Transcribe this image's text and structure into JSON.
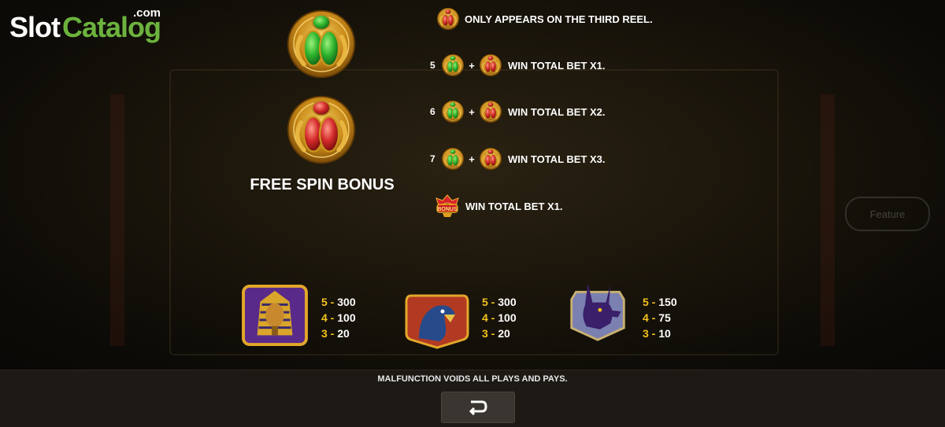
{
  "logo": {
    "slot": "Slot",
    "catalog": "Catalog",
    "com": ".com"
  },
  "background": {
    "feature_label": "Feature"
  },
  "bonus": {
    "title": "FREE SPIN BONUS",
    "rules": [
      {
        "count": "",
        "text": "ONLY APPEARS ON THE THIRD REEL."
      },
      {
        "count": "5",
        "text": "WIN TOTAL BET X1."
      },
      {
        "count": "6",
        "text": "WIN TOTAL BET X2."
      },
      {
        "count": "7",
        "text": "WIN TOTAL BET X3."
      },
      {
        "count": "",
        "badge": "BONUS",
        "text": "WIN TOTAL BET X1."
      }
    ]
  },
  "paytable": [
    {
      "symbol": "pharaoh",
      "pays": [
        {
          "k": "5",
          "v": "300"
        },
        {
          "k": "4",
          "v": "100"
        },
        {
          "k": "3",
          "v": "20"
        }
      ]
    },
    {
      "symbol": "falcon-horus",
      "pays": [
        {
          "k": "5",
          "v": "300"
        },
        {
          "k": "4",
          "v": "100"
        },
        {
          "k": "3",
          "v": "20"
        }
      ]
    },
    {
      "symbol": "anubis",
      "pays": [
        {
          "k": "5",
          "v": "150"
        },
        {
          "k": "4",
          "v": "75"
        },
        {
          "k": "3",
          "v": "10"
        }
      ]
    }
  ],
  "footer": {
    "disclaimer": "MALFUNCTION VOIDS ALL PLAYS AND PAYS."
  },
  "colors": {
    "accent_gold": "#f3c21a",
    "scarab_green": "#2fb52f",
    "scarab_red": "#d42a2a",
    "brand_green": "#6cb33e"
  },
  "icons": {
    "back": "return-arrow-icon"
  }
}
